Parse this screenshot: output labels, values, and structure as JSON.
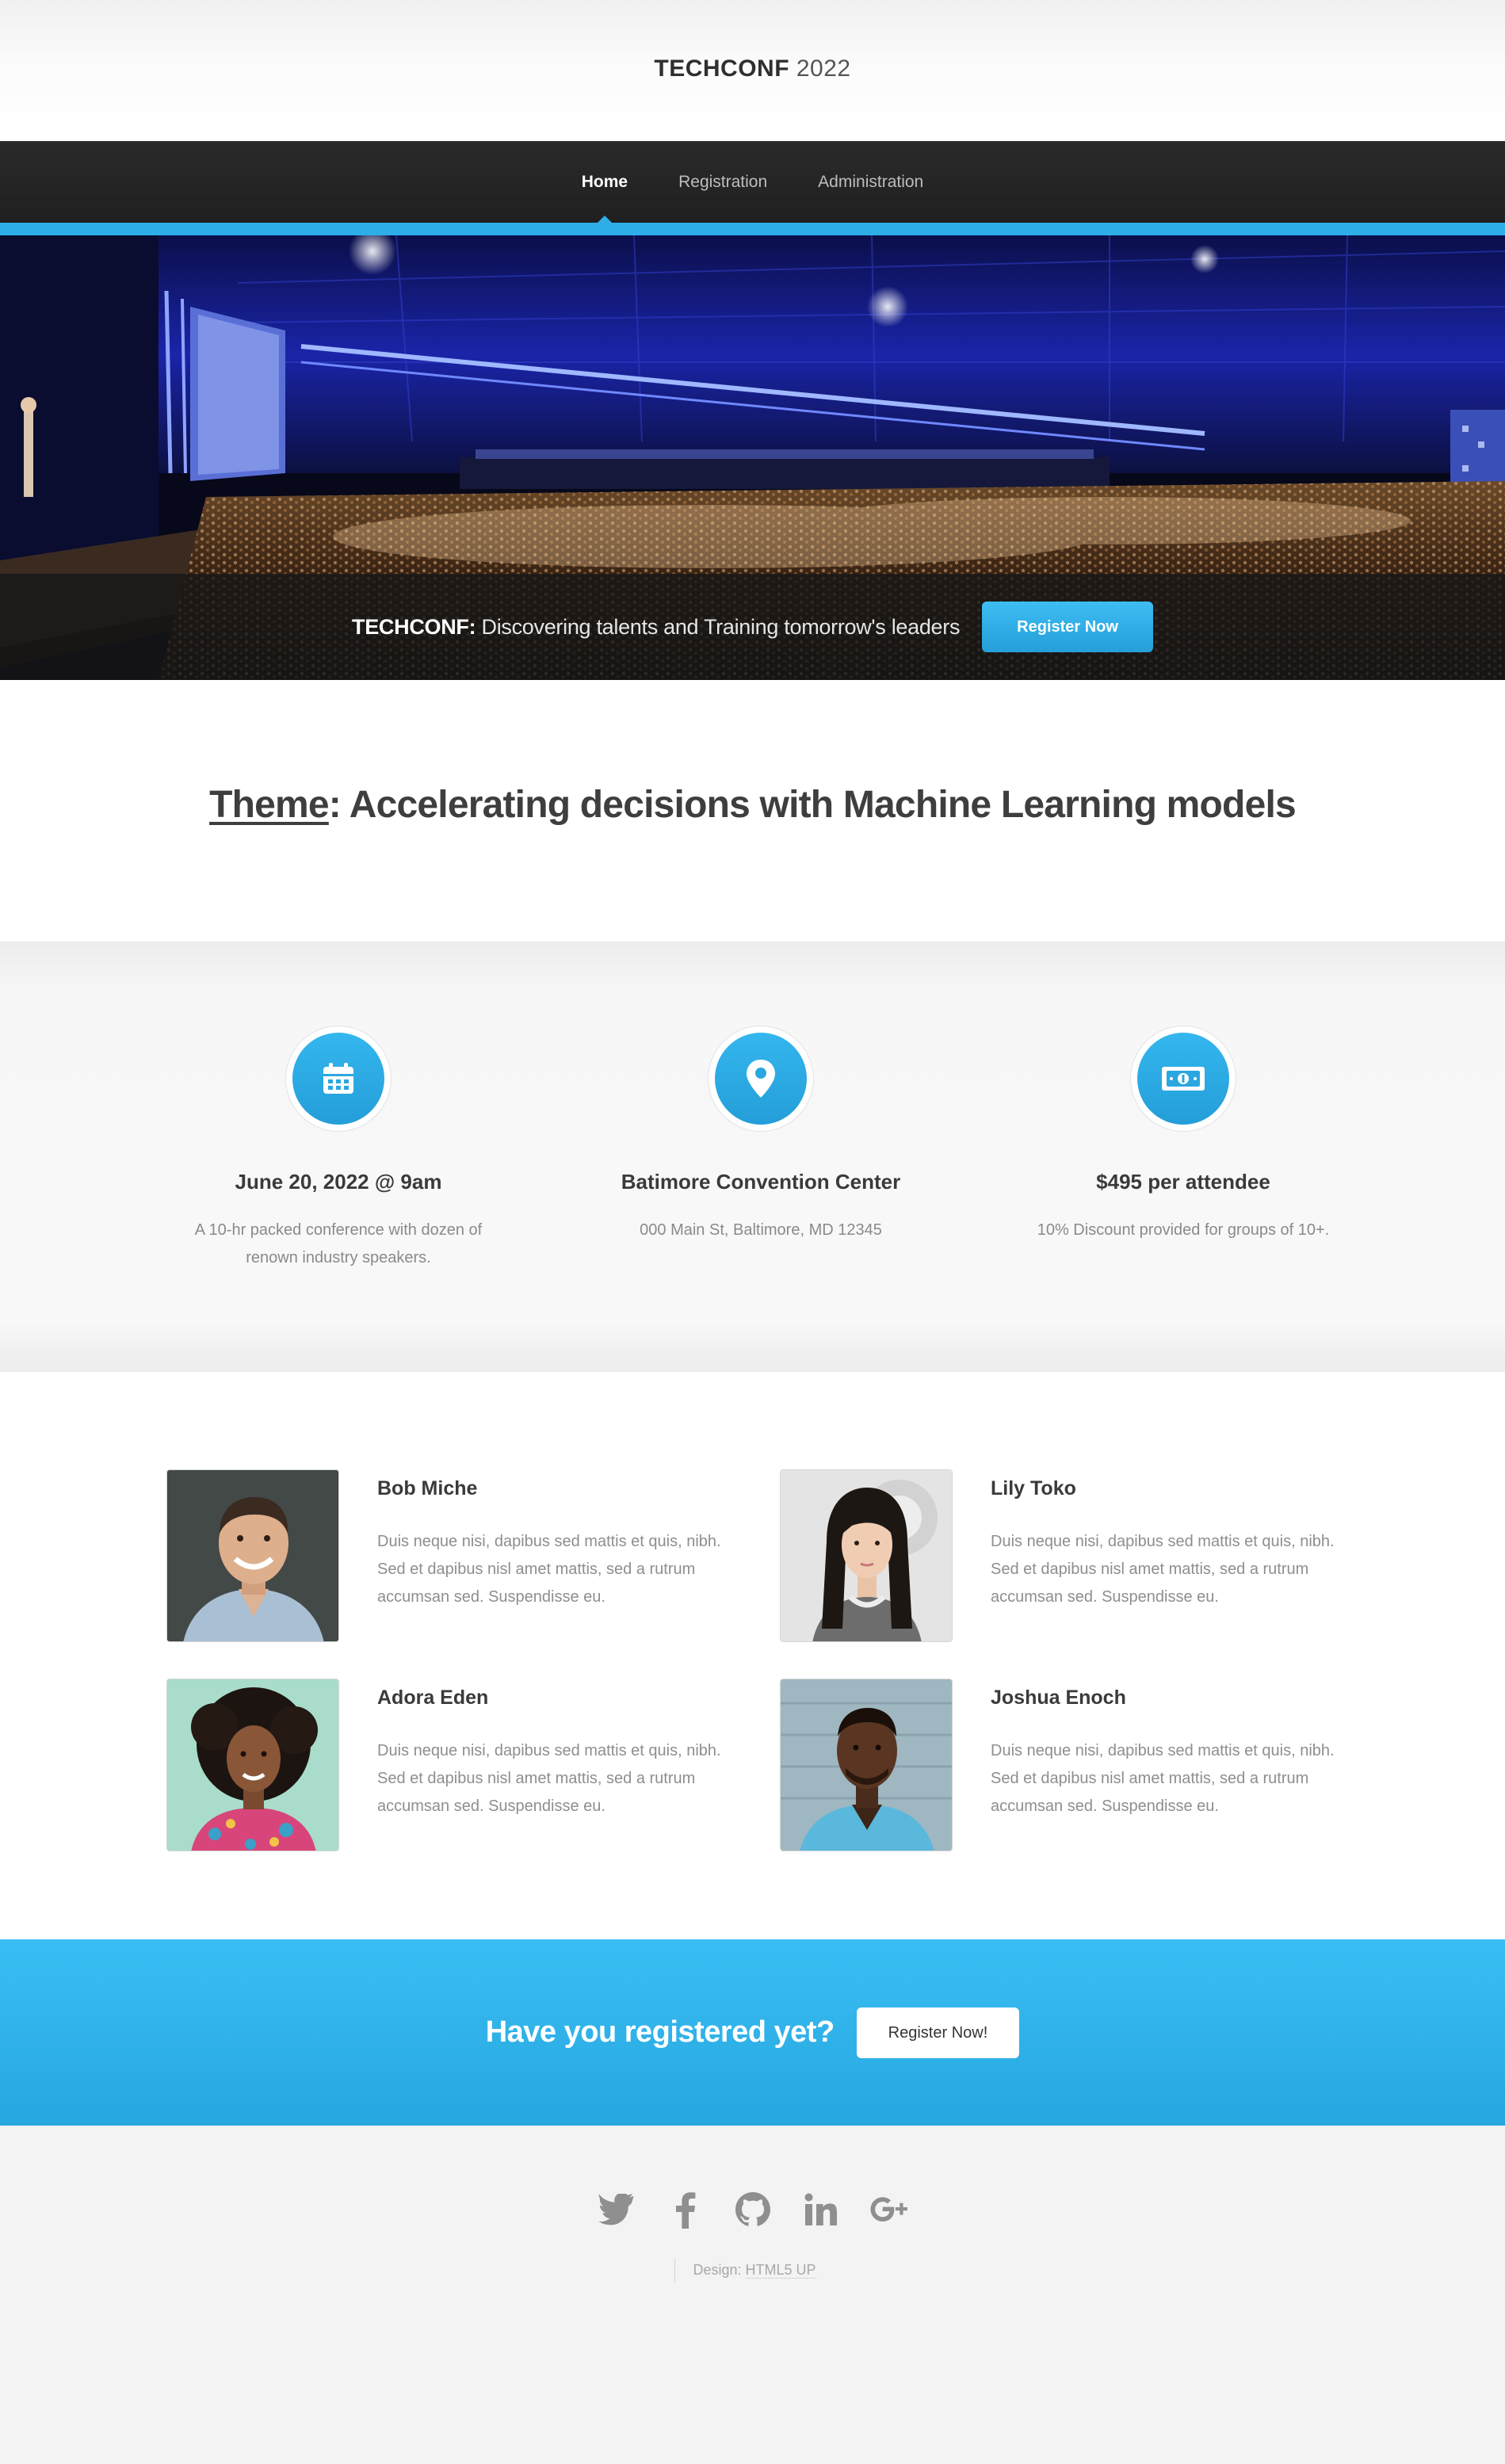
{
  "header": {
    "logo_strong": "TECHCONF",
    "logo_year": "2022"
  },
  "nav": {
    "items": [
      {
        "label": "Home",
        "active": true
      },
      {
        "label": "Registration",
        "active": false
      },
      {
        "label": "Administration",
        "active": false
      }
    ]
  },
  "banner": {
    "brand": "TECHCONF:",
    "tagline": "Discovering talents and Training tomorrow's leaders",
    "button_label": "Register Now"
  },
  "theme": {
    "label": "Theme",
    "text": ": Accelerating decisions with Machine Learning models"
  },
  "features": [
    {
      "icon": "calendar-icon",
      "title": "June 20, 2022 @ 9am",
      "description": "A 10-hr packed conference with dozen of renown industry speakers."
    },
    {
      "icon": "location-pin-icon",
      "title": "Batimore Convention Center",
      "description": "000 Main St, Baltimore, MD 12345"
    },
    {
      "icon": "money-bill-icon",
      "title": "$495 per attendee",
      "description": "10% Discount provided for groups of 10+."
    }
  ],
  "speakers": [
    {
      "name": "Bob Miche",
      "bio": "Duis neque nisi, dapibus sed mattis et quis, nibh. Sed et dapibus nisl amet mattis, sed a rutrum accumsan sed. Suspendisse eu."
    },
    {
      "name": "Lily Toko",
      "bio": "Duis neque nisi, dapibus sed mattis et quis, nibh. Sed et dapibus nisl amet mattis, sed a rutrum accumsan sed. Suspendisse eu."
    },
    {
      "name": "Adora Eden",
      "bio": "Duis neque nisi, dapibus sed mattis et quis, nibh. Sed et dapibus nisl amet mattis, sed a rutrum accumsan sed. Suspendisse eu."
    },
    {
      "name": "Joshua Enoch",
      "bio": "Duis neque nisi, dapibus sed mattis et quis, nibh. Sed et dapibus nisl amet mattis, sed a rutrum accumsan sed. Suspendisse eu."
    }
  ],
  "cta": {
    "text": "Have you registered yet?",
    "button_label": "Register Now!"
  },
  "footer": {
    "social_icons": [
      "twitter-icon",
      "facebook-icon",
      "github-icon",
      "linkedin-icon",
      "google-plus-icon"
    ],
    "credit_prefix": "Design:",
    "credit_link": "HTML5 UP"
  },
  "colors": {
    "accent": "#2eaee8",
    "nav_background": "#222222",
    "text_dark": "#3e3e3e",
    "text_muted": "#8e8e8e"
  }
}
